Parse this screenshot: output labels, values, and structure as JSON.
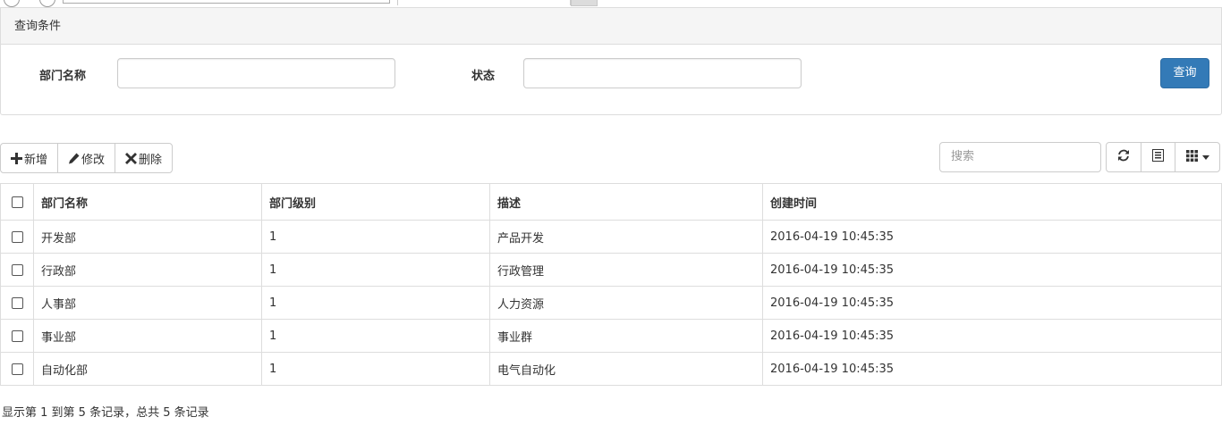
{
  "query_panel": {
    "title": "查询条件",
    "dept_name_label": "部门名称",
    "dept_name_value": "",
    "status_label": "状态",
    "status_value": "",
    "query_button": "查询"
  },
  "toolbar": {
    "add_label": "新增",
    "edit_label": "修改",
    "delete_label": "删除",
    "search_placeholder": "搜索"
  },
  "table": {
    "headers": [
      "部门名称",
      "部门级别",
      "描述",
      "创建时间"
    ],
    "rows": [
      {
        "name": "开发部",
        "level": "1",
        "desc": "产品开发",
        "created": "2016-04-19 10:45:35"
      },
      {
        "name": "行政部",
        "level": "1",
        "desc": "行政管理",
        "created": "2016-04-19 10:45:35"
      },
      {
        "name": "人事部",
        "level": "1",
        "desc": "人力资源",
        "created": "2016-04-19 10:45:35"
      },
      {
        "name": "事业部",
        "level": "1",
        "desc": "事业群",
        "created": "2016-04-19 10:45:35"
      },
      {
        "name": "自动化部",
        "level": "1",
        "desc": "电气自动化",
        "created": "2016-04-19 10:45:35"
      }
    ]
  },
  "pagination": {
    "info": "显示第 1 到第 5 条记录，总共 5 条记录"
  },
  "colors": {
    "primary": "#337ab7",
    "border": "#dddddd",
    "panel_head_bg": "#f5f5f5"
  }
}
